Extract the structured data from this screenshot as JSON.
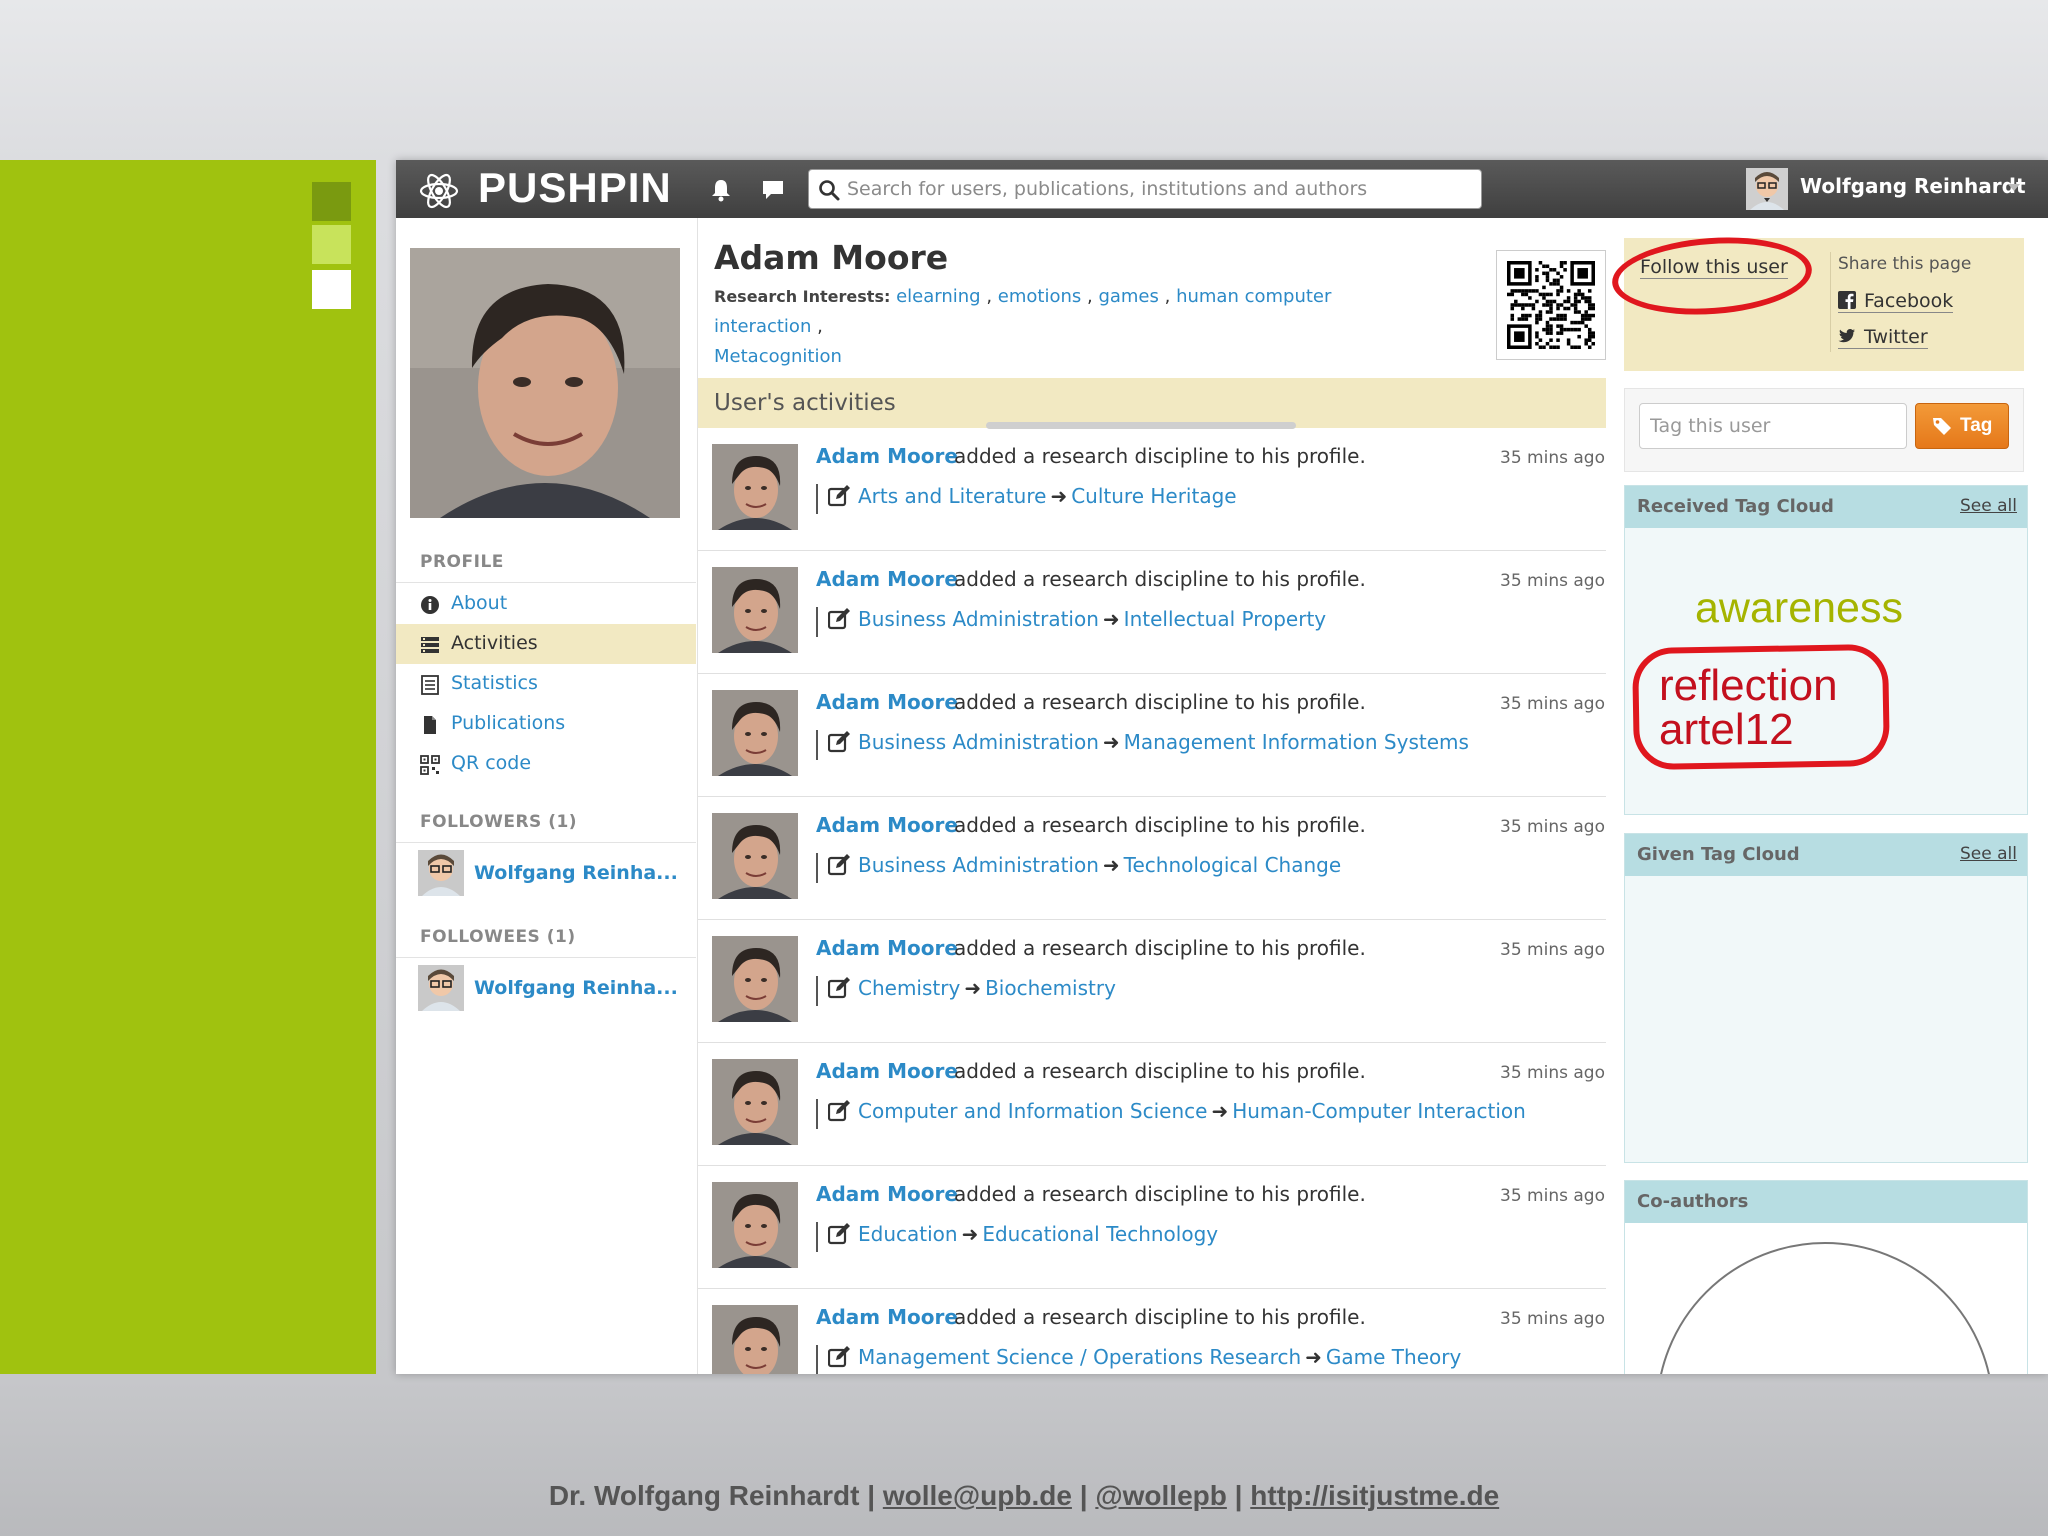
{
  "app": {
    "brand": "PUSHPIN",
    "search_placeholder": "Search for users, publications, institutions and authors",
    "current_user": "Wolfgang Reinhardt"
  },
  "sidebar": {
    "profile_heading": "PROFILE",
    "items": [
      {
        "label": "About",
        "icon": "info-icon",
        "active": false
      },
      {
        "label": "Activities",
        "icon": "activities-icon",
        "active": true
      },
      {
        "label": "Statistics",
        "icon": "statistics-icon",
        "active": false
      },
      {
        "label": "Publications",
        "icon": "document-icon",
        "active": false
      },
      {
        "label": "QR code",
        "icon": "qr-icon",
        "active": false
      }
    ],
    "followers_heading": "FOLLOWERS (1)",
    "followers": [
      {
        "name": "Wolfgang Reinha..."
      }
    ],
    "followees_heading": "FOLLOWEES (1)",
    "followees": [
      {
        "name": "Wolfgang Reinha..."
      }
    ]
  },
  "profile": {
    "name": "Adam Moore",
    "interests_label": "Research Interests:",
    "interests": [
      "elearning",
      "emotions",
      "games",
      "human computer interaction",
      "Metacognition"
    ]
  },
  "activities": {
    "heading": "User's activities",
    "items": [
      {
        "actor": "Adam Moore",
        "action": "added a research discipline to his profile.",
        "time": "35 mins ago",
        "from": "Arts and Literature",
        "to": "Culture Heritage"
      },
      {
        "actor": "Adam Moore",
        "action": "added a research discipline to his profile.",
        "time": "35 mins ago",
        "from": "Business Administration",
        "to": "Intellectual Property"
      },
      {
        "actor": "Adam Moore",
        "action": "added a research discipline to his profile.",
        "time": "35 mins ago",
        "from": "Business Administration",
        "to": "Management Information Systems"
      },
      {
        "actor": "Adam Moore",
        "action": "added a research discipline to his profile.",
        "time": "35 mins ago",
        "from": "Business Administration",
        "to": "Technological Change"
      },
      {
        "actor": "Adam Moore",
        "action": "added a research discipline to his profile.",
        "time": "35 mins ago",
        "from": "Chemistry",
        "to": "Biochemistry"
      },
      {
        "actor": "Adam Moore",
        "action": "added a research discipline to his profile.",
        "time": "35 mins ago",
        "from": "Computer and Information Science",
        "to": "Human-Computer Interaction"
      },
      {
        "actor": "Adam Moore",
        "action": "added a research discipline to his profile.",
        "time": "35 mins ago",
        "from": "Education",
        "to": "Educational Technology"
      },
      {
        "actor": "Adam Moore",
        "action": "added a research discipline to his profile.",
        "time": "35 mins ago",
        "from": "Management Science / Operations Research",
        "to": "Game Theory"
      }
    ]
  },
  "share": {
    "follow_label": "Follow this user",
    "share_label": "Share this page",
    "facebook": "Facebook",
    "twitter": "Twitter"
  },
  "tagging": {
    "input_placeholder": "Tag this user",
    "button_label": "Tag"
  },
  "received_cloud": {
    "title": "Received Tag Cloud",
    "see_all": "See all",
    "tags": [
      "awareness",
      "reflection",
      "artel12"
    ]
  },
  "given_cloud": {
    "title": "Given Tag Cloud",
    "see_all": "See all"
  },
  "coauthors": {
    "title": "Co-authors"
  },
  "footer": {
    "author": "Dr. Wolfgang Reinhardt",
    "email": "wolle@upb.de",
    "twitter": "@wollepb",
    "url": "http://isitjustme.de",
    "separator": " | "
  },
  "colors": {
    "accent_green": "#a0c20f",
    "link_blue": "#2c8ac7",
    "highlight": "#f2e9c2",
    "annotation_red": "#e0171e",
    "tag_button": "#e5781a"
  }
}
